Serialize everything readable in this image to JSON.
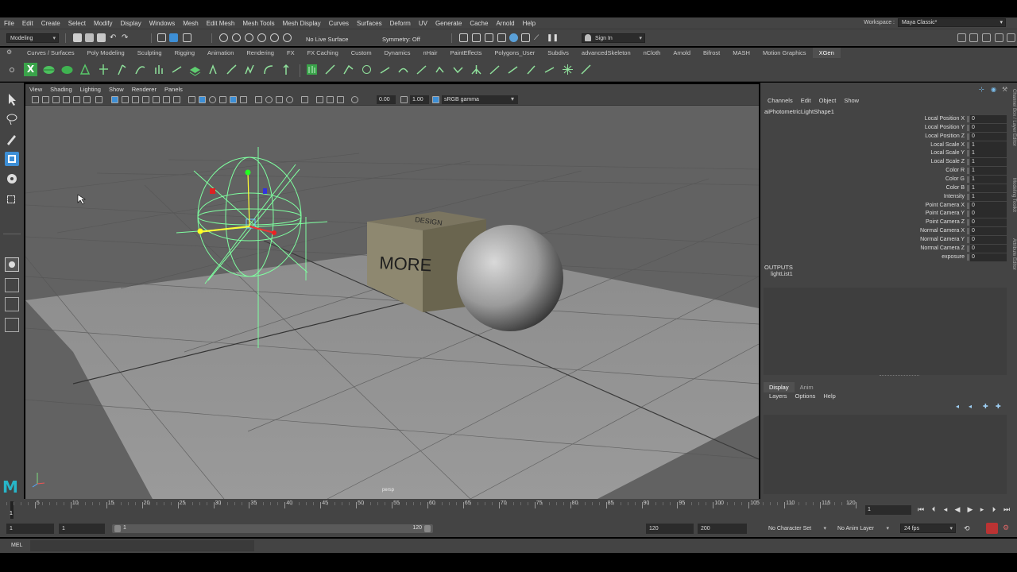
{
  "menubar": {
    "items": [
      "File",
      "Edit",
      "Create",
      "Select",
      "Modify",
      "Display",
      "Windows",
      "Mesh",
      "Edit Mesh",
      "Mesh Tools",
      "Mesh Display",
      "Curves",
      "Surfaces",
      "Deform",
      "UV",
      "Generate",
      "Cache",
      "Arnold",
      "Help"
    ],
    "workspace_label": "Workspace :",
    "workspace_value": "Maya Classic*"
  },
  "statusline": {
    "mode": "Modeling",
    "live_surface": "No Live Surface",
    "symmetry": "Symmetry: Off",
    "sign_in": "Sign In"
  },
  "shelf": {
    "tabs": [
      "Curves / Surfaces",
      "Poly Modeling",
      "Sculpting",
      "Rigging",
      "Animation",
      "Rendering",
      "FX",
      "FX Caching",
      "Custom",
      "Dynamics",
      "nHair",
      "PaintEffects",
      "Polygons_User",
      "Subdivs",
      "advancedSkeleton",
      "nCloth",
      "Arnold",
      "Bifrost",
      "MASH",
      "Motion Graphics",
      "XGen"
    ],
    "active_tab": "XGen"
  },
  "viewport": {
    "menu": [
      "View",
      "Shading",
      "Lighting",
      "Show",
      "Renderer",
      "Panels"
    ],
    "exposure": "0.00",
    "gamma": "1.00",
    "color_space": "sRGB gamma",
    "camera_label": "persp",
    "cube_text": "MORE",
    "cube_top_text": "DESIGN"
  },
  "channelbox": {
    "menu": [
      "Channels",
      "Edit",
      "Object",
      "Show"
    ],
    "shape_name": "aiPhotometricLightShape1",
    "attributes": [
      {
        "name": "Local Position X",
        "value": "0"
      },
      {
        "name": "Local Position Y",
        "value": "0"
      },
      {
        "name": "Local Position Z",
        "value": "0"
      },
      {
        "name": "Local Scale X",
        "value": "1"
      },
      {
        "name": "Local Scale Y",
        "value": "1"
      },
      {
        "name": "Local Scale Z",
        "value": "1"
      },
      {
        "name": "Color R",
        "value": "1"
      },
      {
        "name": "Color G",
        "value": "1"
      },
      {
        "name": "Color B",
        "value": "1"
      },
      {
        "name": "Intensity",
        "value": "1"
      },
      {
        "name": "Point Camera X",
        "value": "0"
      },
      {
        "name": "Point Camera Y",
        "value": "0"
      },
      {
        "name": "Point Camera Z",
        "value": "0"
      },
      {
        "name": "Normal Camera X",
        "value": "0"
      },
      {
        "name": "Normal Camera Y",
        "value": "0"
      },
      {
        "name": "Normal Camera Z",
        "value": "0"
      },
      {
        "name": "exposure",
        "value": "0"
      }
    ],
    "outputs_label": "OUTPUTS",
    "output_item": "lightList1",
    "side_tabs": [
      "Channel Box / Layer Editor",
      "Modeling Toolkit",
      "Attribute Editor"
    ]
  },
  "layers": {
    "tabs": [
      "Display",
      "Anim"
    ],
    "active_tab": "Display",
    "menu": [
      "Layers",
      "Options",
      "Help"
    ]
  },
  "timeslider": {
    "labels": [
      "1",
      "5",
      "10",
      "15",
      "20",
      "25",
      "30",
      "35",
      "40",
      "45",
      "50",
      "55",
      "60",
      "65",
      "70",
      "75",
      "80",
      "85",
      "90",
      "95",
      "100",
      "105",
      "110",
      "115",
      "120"
    ],
    "current_frame": "1"
  },
  "range": {
    "start": "1",
    "playback_start": "1",
    "range_start": "1",
    "range_end": "120",
    "playback_end": "120",
    "end": "200",
    "character_set": "No Character Set",
    "anim_layer": "No Anim Layer",
    "fps": "24 fps"
  },
  "cmdline": {
    "label": "MEL"
  },
  "colors": {
    "ui_bg": "#444444",
    "viewport_bg": "#626262",
    "field_bg": "#2b2b2b",
    "light_gizmo": "#7fffa0",
    "maya_logo": "#27b6c9",
    "active_tool": "#3d8fd6"
  }
}
